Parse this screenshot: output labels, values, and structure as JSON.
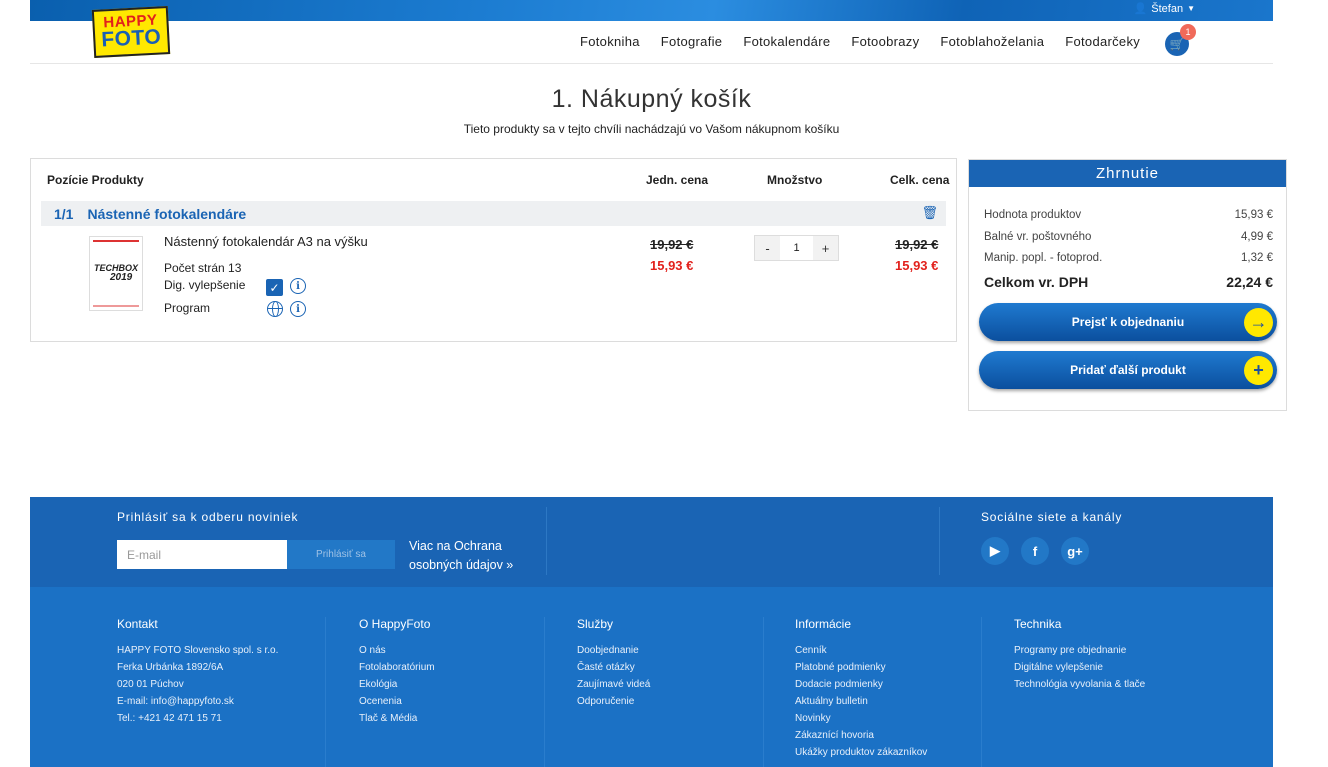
{
  "header": {
    "user": "Štefan",
    "logo_line1": "HAPPY",
    "logo_line2": "FOTO",
    "nav": [
      "Fotokniha",
      "Fotografie",
      "Fotokalendáre",
      "Fotoobrazy",
      "Fotoblahoželania",
      "Fotodarčeky"
    ],
    "cart_count": "1"
  },
  "page": {
    "title": "1. Nákupný košík",
    "subtitle": "Tieto produkty sa v tejto chvíli nachádzajú vo Vašom nákupnom košíku"
  },
  "cart": {
    "headers": {
      "positions": "Pozície Produkty",
      "unit_price": "Jedn. cena",
      "quantity": "Množstvo",
      "total_price": "Celk. cena"
    },
    "group": {
      "position": "1/1",
      "name": "Nástenné fotokalendáre"
    },
    "item": {
      "name": "Nástenný fotokalendár A3 na výšku",
      "thumb_line1": "TECHBOX",
      "thumb_line2": "2019",
      "pages": "Počet strán 13",
      "enhancement_label": "Dig. vylepšenie",
      "program_label": "Program",
      "unit_old": "19,92 €",
      "unit_new": "15,93 €",
      "qty": "1",
      "total_old": "19,92 €",
      "total_new": "15,93 €"
    }
  },
  "summary": {
    "title": "Zhrnutie",
    "rows": [
      {
        "label": "Hodnota produktov",
        "value": "15,93 €"
      },
      {
        "label": "Balné vr. poštovného",
        "value": "4,99 €"
      },
      {
        "label": "Manip. popl. - fotoprod.",
        "value": "1,32 €"
      }
    ],
    "total_label": "Celkom vr. DPH",
    "total_value": "22,24 €",
    "checkout_label": "Prejsť k objednaniu",
    "add_label": "Pridať ďalší produkt"
  },
  "footer": {
    "newsletter_title": "Prihlásiť sa k odberu noviniek",
    "email_placeholder": "E-mail",
    "subscribe_label": "Prihlásiť sa",
    "privacy_link": "Viac na Ochrana osobných údajov »",
    "social_title": "Sociálne siete a kanály",
    "columns": [
      {
        "heading": "Kontakt",
        "items": [
          "HAPPY FOTO Slovensko spol. s r.o.",
          "Ferka Urbánka 1892/6A",
          "020 01 Púchov",
          "E-mail: info@happyfoto.sk",
          "Tel.: +421 42 471 15 71"
        ]
      },
      {
        "heading": "O HappyFoto",
        "items": [
          "O nás",
          "Fotolaboratórium",
          "Ekológia",
          "Ocenenia",
          "Tlač & Média"
        ]
      },
      {
        "heading": "Služby",
        "items": [
          "Doobjednanie",
          "Časté otázky",
          "Zaujímavé videá",
          "Odporučenie"
        ]
      },
      {
        "heading": "Informácie",
        "items": [
          "Cenník",
          "Platobné podmienky",
          "Dodacie podmienky",
          "Aktuálny bulletin",
          "Novinky",
          "Zákaznící hovoria",
          "Ukážky produktov zákazníkov"
        ]
      },
      {
        "heading": "Technika",
        "items": [
          "Programy pre objednanie",
          "Digitálne vylepšenie",
          "Technológia vyvolania & tlače"
        ]
      }
    ]
  }
}
